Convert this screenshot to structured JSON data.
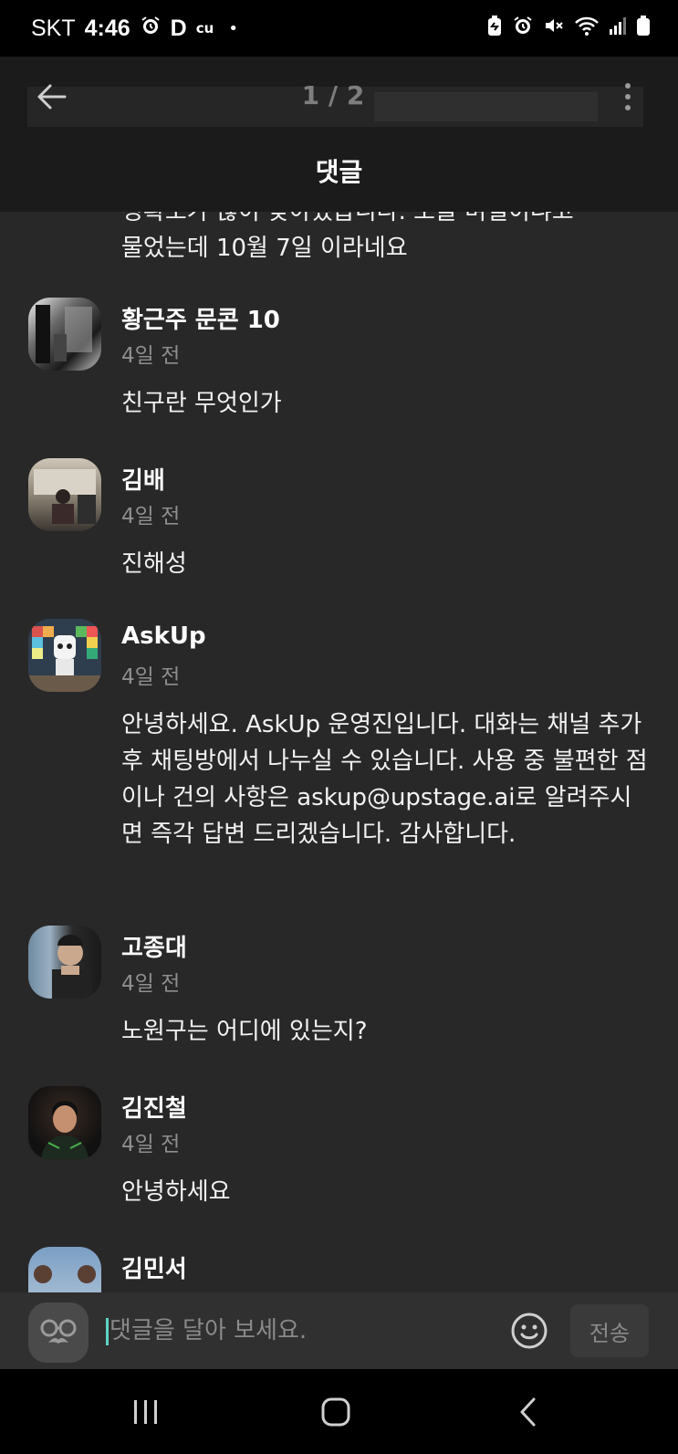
{
  "status_bar": {
    "carrier": "SKT",
    "time": "4:46",
    "left_icons": [
      "alarm-icon",
      "d-app-icon",
      "cu-app-icon",
      "notification-dot"
    ],
    "d_label": "D",
    "cu_label": "cu",
    "dot": "•",
    "right_icons": [
      "battery-saver-icon",
      "alarm-icon",
      "mute-icon",
      "wifi-icon",
      "signal-icon",
      "battery-icon"
    ]
  },
  "header": {
    "pager": "1 / 2",
    "title": "댓글",
    "back_icon": "back-arrow-icon",
    "more_icon": "more-vertical-icon"
  },
  "previous_comment_tail": {
    "line1": "정확도가 많이 낮아졌습니다. 오늘 며칠이냐고",
    "line2": "물었는데 10월 7일 이라네요"
  },
  "comments": [
    {
      "name": "황근주 문콘 10",
      "time": "4일 전",
      "body": "친구란 무엇인가"
    },
    {
      "name": "김배",
      "time": "4일 전",
      "body": "진해성"
    },
    {
      "name": "AskUp",
      "time": "4일 전",
      "body": "안녕하세요. AskUp 운영진입니다. 대화는 채널 추가 후 채팅방에서 나누실 수 있습니다. 사용 중 불편한 점이나 건의 사항은 askup@upstage.ai로 알려주시면 즉각 답변 드리겠습니다. 감사합니다."
    },
    {
      "name": "고종대",
      "time": "4일 전",
      "body": "노원구는 어디에 있는지?"
    },
    {
      "name": "김진철",
      "time": "4일 전",
      "body": "안녕하세요"
    },
    {
      "name": "김민서",
      "time": "",
      "body": ""
    }
  ],
  "input_bar": {
    "placeholder": "댓글을 달아 보세요.",
    "value": "",
    "send_label": "전송",
    "emoji_icon": "smiley-icon",
    "avatar_icon": "glasses-mustache-icon"
  },
  "nav_bar": {
    "icons": [
      "recent-apps-icon",
      "home-icon",
      "back-icon"
    ]
  },
  "colors": {
    "background": "#282828",
    "header": "#1b1b1b",
    "status_bar": "#000000",
    "text": "#f2f2f2",
    "muted": "#8e8e8e",
    "caret": "#5fd3c4"
  }
}
